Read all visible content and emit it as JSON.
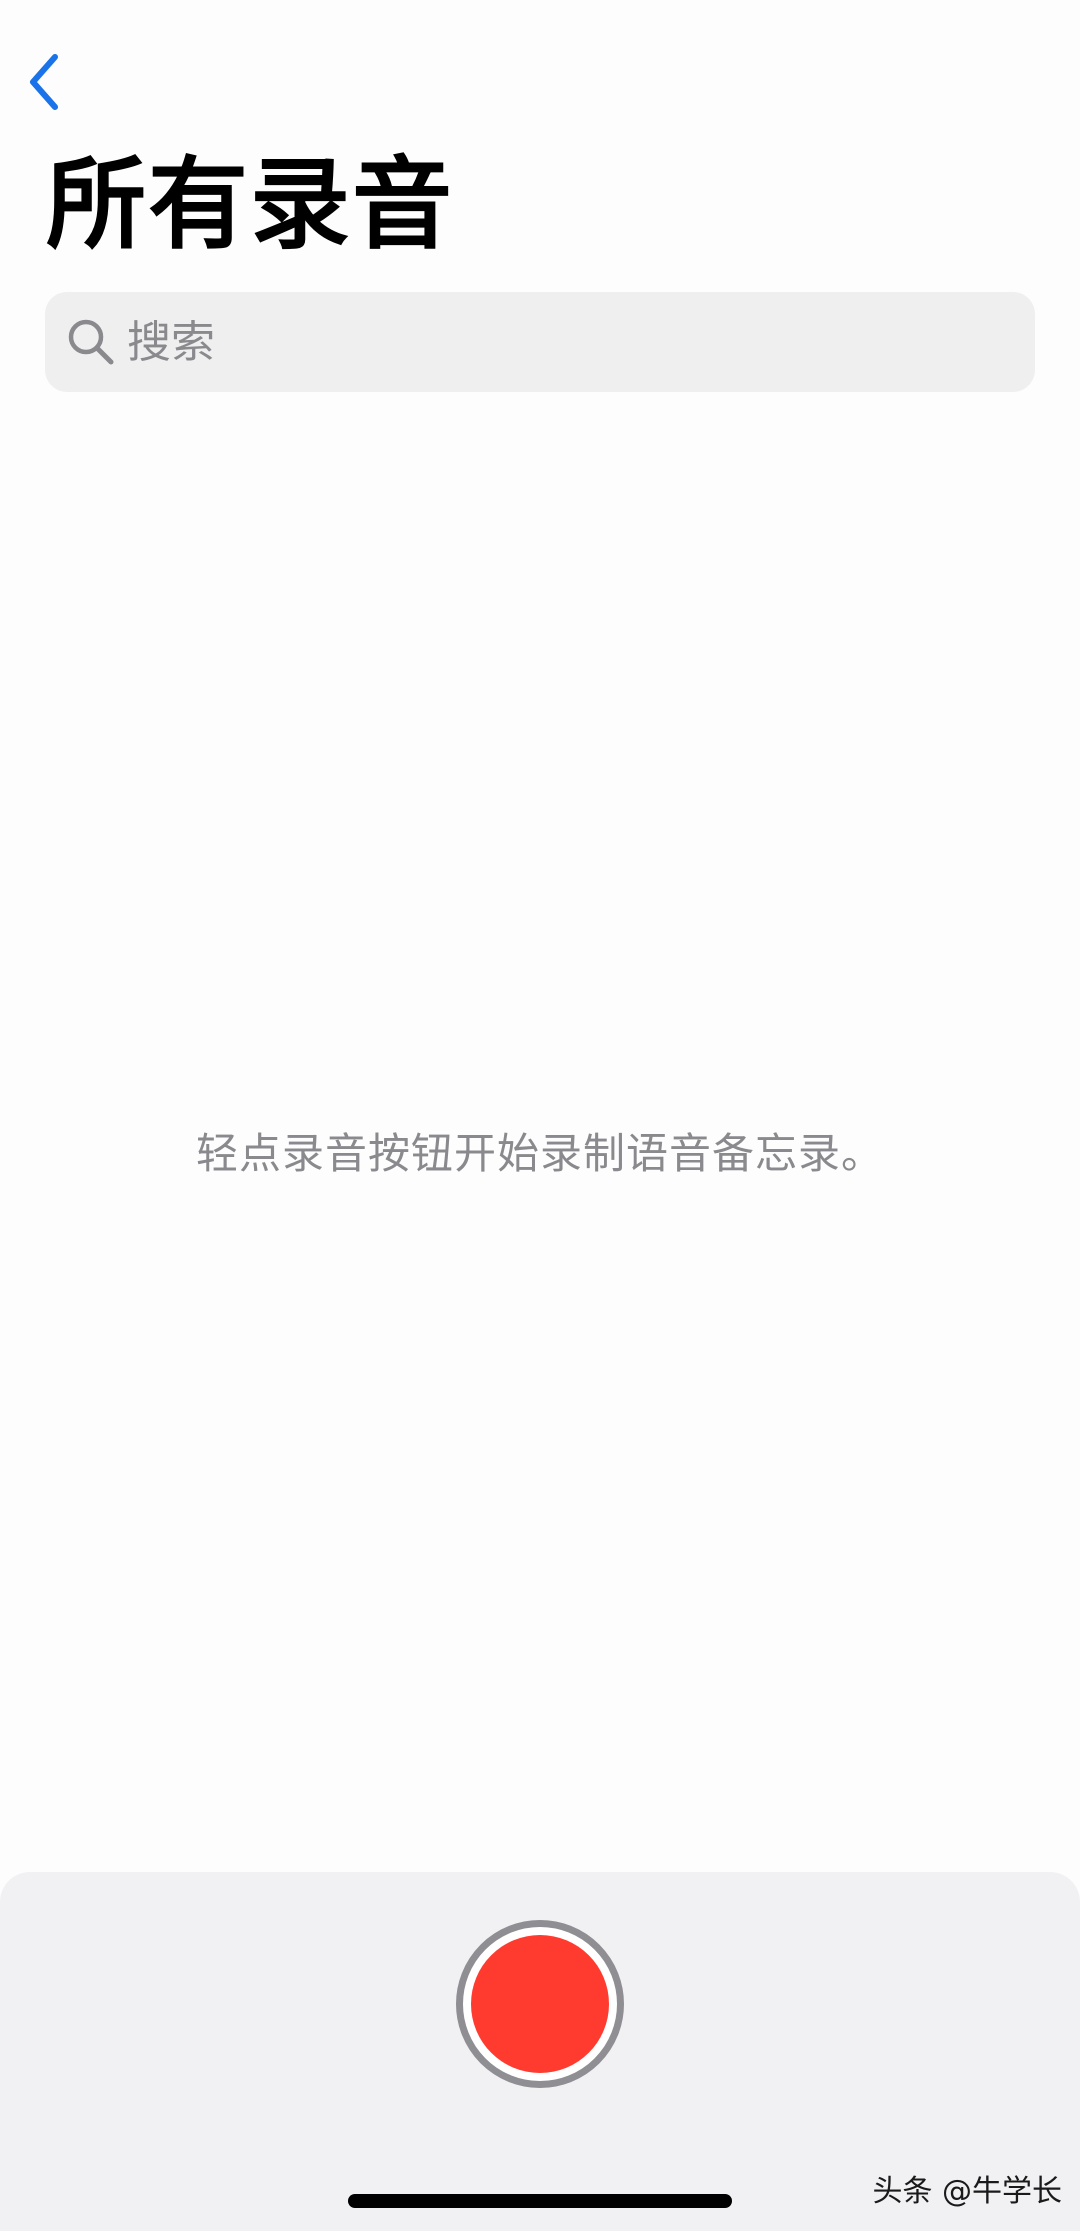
{
  "header": {
    "back_icon": "chevron-left-icon",
    "title": "所有录音"
  },
  "search": {
    "icon": "search-icon",
    "placeholder": "搜索"
  },
  "main": {
    "empty_hint": "轻点录音按钮开始录制语音备忘录。"
  },
  "toolbar": {
    "record_icon": "record-icon"
  },
  "watermark": "头条 @牛学长",
  "colors": {
    "accent": "#1a73e8",
    "record": "#ff3b30",
    "record_ring": "#8e8e93",
    "search_bg": "#efeff0",
    "hint_text": "#8a8a8e",
    "bottom_panel": "#f1f1f4"
  }
}
